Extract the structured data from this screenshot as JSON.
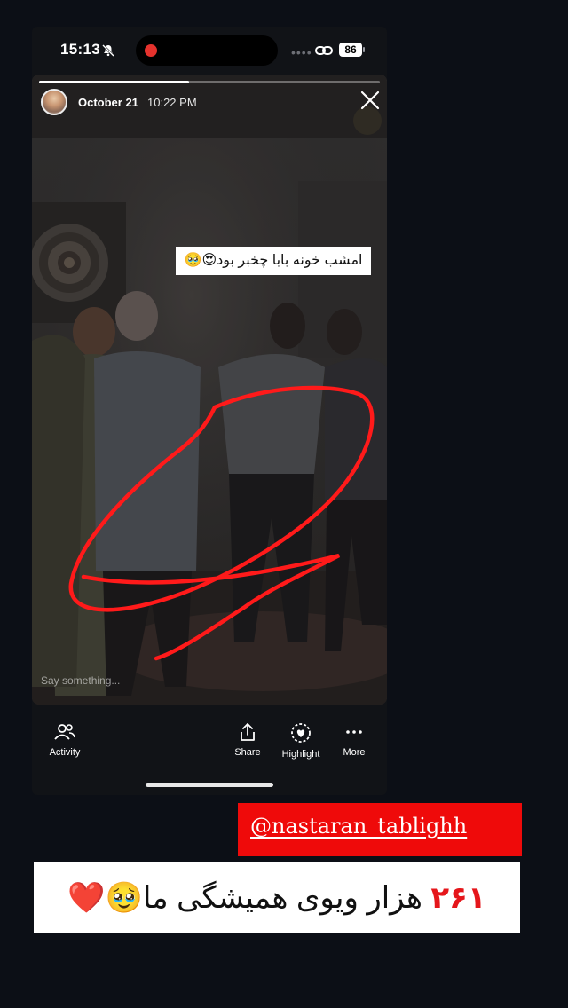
{
  "status_bar": {
    "time": "15:13",
    "battery": "86"
  },
  "story": {
    "date": "October 21",
    "time": "10:22 PM",
    "caption": "امشب خونه بابا چخبر بود😍🥹",
    "reply_placeholder": "Say something...",
    "progress_fraction": 0.44
  },
  "actions": {
    "activity": "Activity",
    "share": "Share",
    "highlight": "Highlight",
    "more": "More"
  },
  "overlay": {
    "handle": "@nastaran_tablighh",
    "views_number": "۲۶۱",
    "views_text": " هزار ویوی همیشگی ما🥹❤️"
  },
  "colors": {
    "banner_red": "#ef0a0a",
    "number_red": "#e5161b",
    "drawing_red": "#ff1a1a"
  }
}
